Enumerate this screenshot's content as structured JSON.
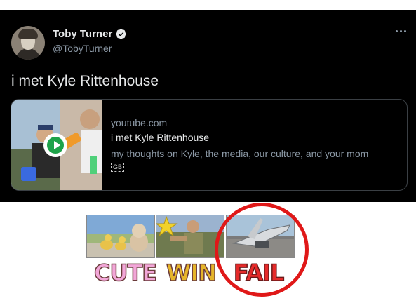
{
  "tweet": {
    "author_name": "Toby Turner",
    "author_handle": "@TobyTurner",
    "text": "i met Kyle Rittenhouse",
    "verified": true,
    "accent_color": "#1d9bf0"
  },
  "card": {
    "domain": "youtube.com",
    "title": "i met Kyle Rittenhouse",
    "description": "my thoughts on Kyle, the media, our culture, and your mom",
    "badge": "GB",
    "play_icon": "play-icon",
    "play_color": "#1fa34a"
  },
  "meme": {
    "labels": [
      "CUTE",
      "WIN",
      "FAIL"
    ],
    "highlight_color": "#e01818"
  }
}
